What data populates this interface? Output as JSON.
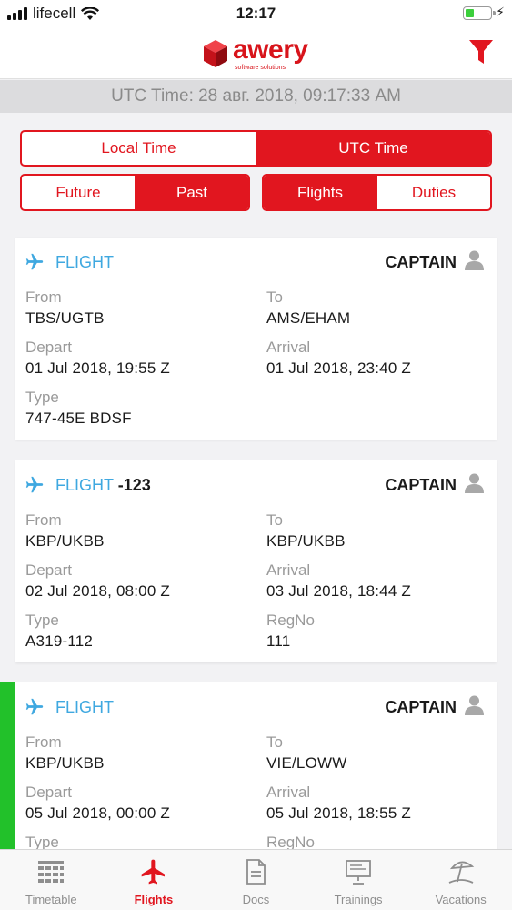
{
  "status_bar": {
    "carrier": "lifecell",
    "time": "12:17"
  },
  "header": {
    "logo_name": "awery",
    "logo_subtitle": "software solutions",
    "utc_time": "UTC Time: 28 авг. 2018, 09:17:33 AM"
  },
  "time_toggle": {
    "local": "Local Time",
    "utc": "UTC Time",
    "selected": "utc"
  },
  "period_toggle": {
    "future": "Future",
    "past": "Past",
    "selected": "past"
  },
  "type_toggle": {
    "flights": "Flights",
    "duties": "Duties",
    "selected": "flights"
  },
  "cards": [
    {
      "type_label": "FLIGHT",
      "number": "",
      "role": "CAPTAIN",
      "from_label": "From",
      "from": "TBS/UGTB",
      "to_label": "To",
      "to": "AMS/EHAM",
      "depart_label": "Depart",
      "depart": "01 Jul 2018, 19:55 Z",
      "arrival_label": "Arrival",
      "arrival": "01 Jul 2018, 23:40 Z",
      "aircraft_label": "Type",
      "aircraft": "747-45E BDSF",
      "regno_label": "",
      "regno": ""
    },
    {
      "type_label": "FLIGHT",
      "number": "-123",
      "role": "CAPTAIN",
      "from_label": "From",
      "from": "KBP/UKBB",
      "to_label": "To",
      "to": "KBP/UKBB",
      "depart_label": "Depart",
      "depart": "02 Jul 2018, 08:00 Z",
      "arrival_label": "Arrival",
      "arrival": "03 Jul 2018, 18:44 Z",
      "aircraft_label": "Type",
      "aircraft": "A319-112",
      "regno_label": "RegNo",
      "regno": "111"
    },
    {
      "type_label": "FLIGHT",
      "number": "",
      "role": "CAPTAIN",
      "from_label": "From",
      "from": "KBP/UKBB",
      "to_label": "To",
      "to": "VIE/LOWW",
      "depart_label": "Depart",
      "depart": "05 Jul 2018, 00:00 Z",
      "arrival_label": "Arrival",
      "arrival": "05 Jul 2018, 18:55 Z",
      "aircraft_label": "Type",
      "aircraft": "",
      "regno_label": "RegNo",
      "regno": ""
    }
  ],
  "tabs": [
    {
      "label": "Timetable",
      "icon": "timetable-icon"
    },
    {
      "label": "Flights",
      "icon": "plane-icon",
      "active": true
    },
    {
      "label": "Docs",
      "icon": "document-icon"
    },
    {
      "label": "Trainings",
      "icon": "presentation-icon"
    },
    {
      "label": "Vacations",
      "icon": "beach-umbrella-icon"
    }
  ],
  "colors": {
    "accent": "#e1161f",
    "flight_blue": "#3fa8e0",
    "active_bar": "#22c12a"
  }
}
